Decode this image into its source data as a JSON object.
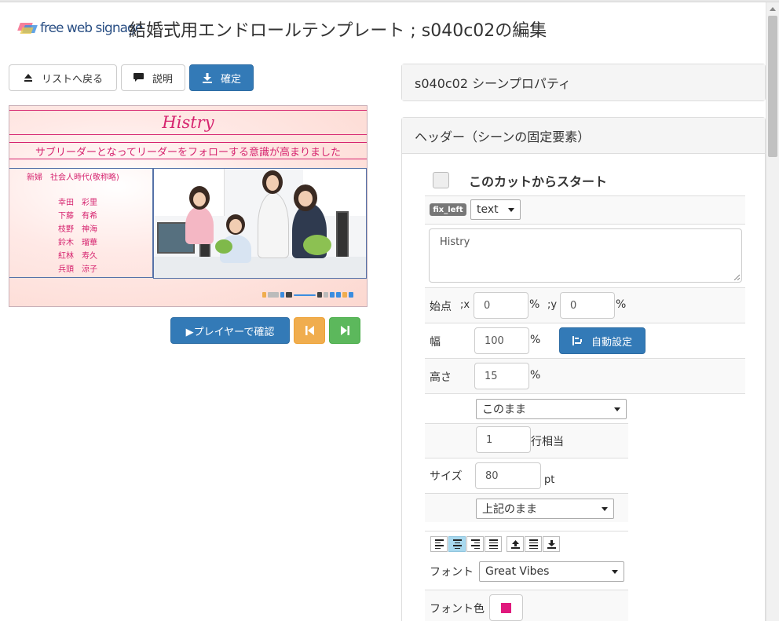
{
  "header": {
    "logo_text": "free web signage",
    "title": "結婚式用エンドロールテンプレート ; s040c02の編集"
  },
  "toolbar": {
    "back_label": "リストへ戻る",
    "help_label": "説明",
    "confirm_label": "確定"
  },
  "preview": {
    "heading": "Histry",
    "subtitle": "サブリーダーとなってリーダーをフォローする意識が高まりました",
    "roles": "新婦　社会人時代(敬称略)",
    "names": "幸田　彩里\n下藤　有希\n枝野　神海\n鈴木　瑠華\n紅林　寿久\n兵頭　涼子"
  },
  "player": {
    "play_label": "▶プレイヤーで確認"
  },
  "panels": {
    "scene_props": "s040c02 シーンプロパティ",
    "header_section": "ヘッダー（シーンの固定要素）"
  },
  "form": {
    "start_label": "このカットからスタート",
    "badge": "fix_left",
    "type_select": "text",
    "text_value": "Histry",
    "start_point_label": "始点",
    "x_label": ";x",
    "x_value": "0",
    "y_label": ";y",
    "y_value": "0",
    "percent": "%",
    "width_label": "幅",
    "width_value": "100",
    "auto_label": "自動設定",
    "height_label": "高さ",
    "height_value": "15",
    "mode_select": "このまま",
    "line_value": "1",
    "line_suffix": "行相当",
    "size_label": "サイズ",
    "size_value": "80",
    "size_unit": "pt",
    "size_mode_select": "上記のまま",
    "font_label": "フォント",
    "font_select": "Great Vibes",
    "font_color_label": "フォント色"
  },
  "colors": {
    "accent": "#337ab7",
    "heading_pink": "#d6246f",
    "font_color_swatch": "#e0197d"
  }
}
